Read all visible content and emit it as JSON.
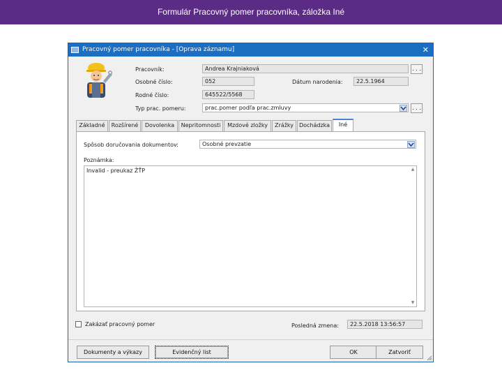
{
  "slide": {
    "title": "Formulár Pracovný pomer pracovníka, záložka Iné"
  },
  "window": {
    "title": "Pracovný pomer pracovníka - [Oprava záznamu]",
    "close": "✕"
  },
  "header": {
    "pracovnik_label": "Pracovník:",
    "pracovnik_value": "Andrea Krajniaková",
    "osobne_cislo_label": "Osobné číslo:",
    "osobne_cislo_value": "052",
    "datum_narodenia_label": "Dátum narodenia:",
    "datum_narodenia_value": "22.5.1964",
    "rodne_cislo_label": "Rodné číslo:",
    "rodne_cislo_value": "645522/5568",
    "typ_label": "Typ prac. pomeru:",
    "typ_value": "prac.pomer podľa prac.zmluvy",
    "dots": ". . ."
  },
  "tabs": [
    {
      "label": "Základné"
    },
    {
      "label": "Rozšírené"
    },
    {
      "label": "Dovolenka"
    },
    {
      "label": "Nepritomnosti"
    },
    {
      "label": "Mzdové zložky"
    },
    {
      "label": "Zrážky"
    },
    {
      "label": "Dochádzka"
    },
    {
      "label": "Iné"
    }
  ],
  "ine": {
    "sposob_label": "Spôsob doručovania dokumentov:",
    "sposob_value": "Osobné prevzatie",
    "poznamka_label": "Poznámka:",
    "poznamka_value": "Invalid - preukaz ŽŤP"
  },
  "footer": {
    "zakazat_label": "Zakázať pracovný pomer",
    "posledna_zmena_label": "Posledná zmena:",
    "posledna_zmena_value": "22.5.2018 13:56:57"
  },
  "buttons": {
    "dokumenty": "Dokumenty a výkazy",
    "evidencny": "Evidenčný list",
    "ok": "OK",
    "zatvorit": "Zatvoriť"
  },
  "colors": {
    "header_bg": "#5b2b86",
    "titlebar_bg": "#1b6ec2",
    "active_tab_accent": "#4a86cf"
  },
  "icons": [
    "worker-icon",
    "window-app-icon",
    "close-icon",
    "dropdown-arrow-icon",
    "resize-grip-icon"
  ]
}
